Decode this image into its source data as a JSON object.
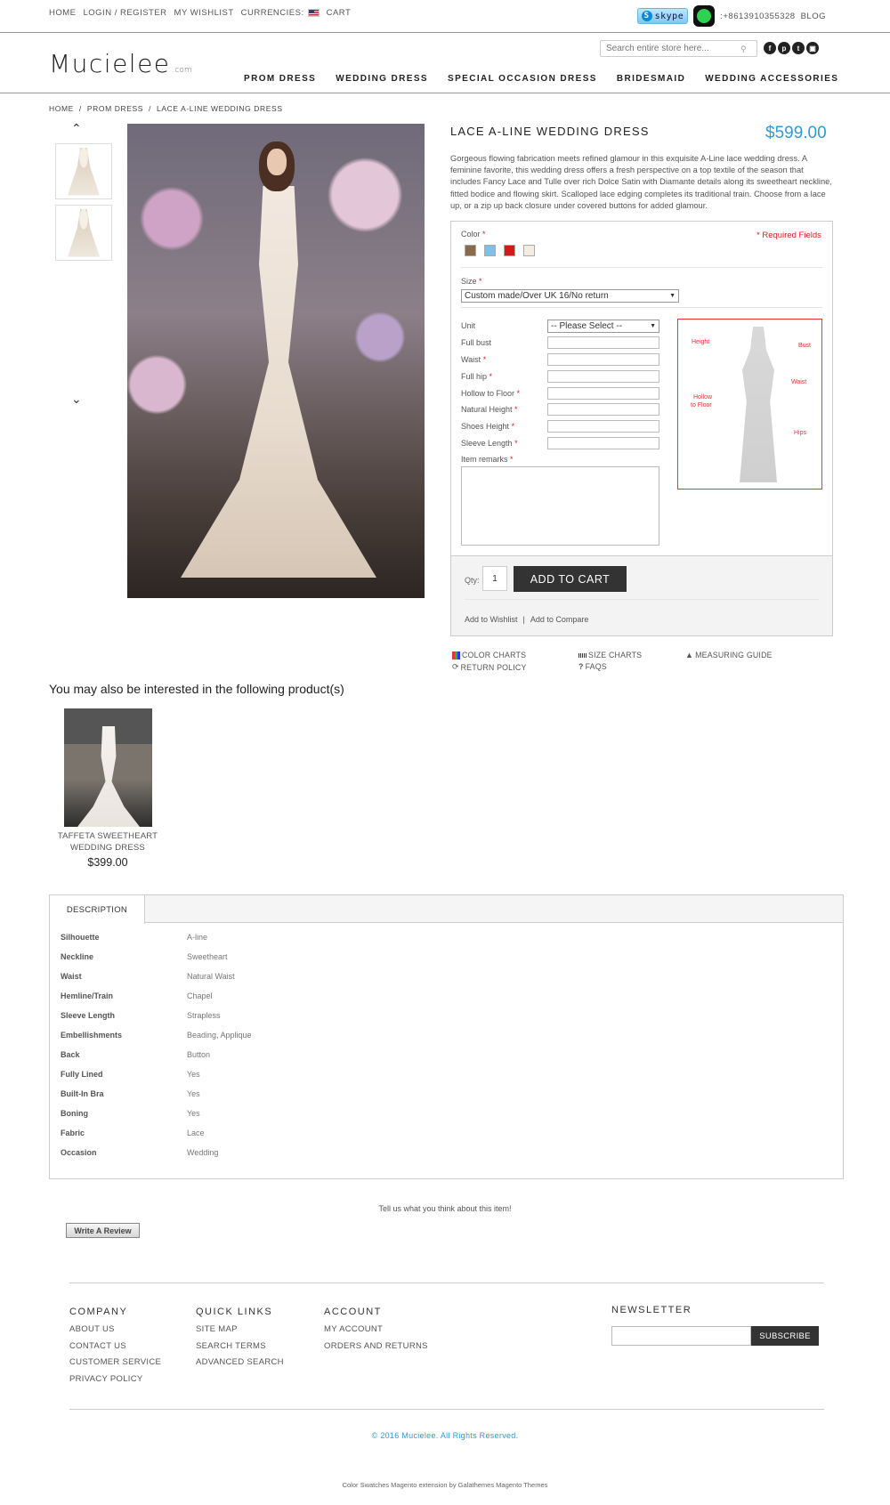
{
  "toplinks": {
    "home": "HOME",
    "login": "LOGIN / REGISTER",
    "wishlist": "MY WISHLIST",
    "currencies": "CURRENCIES:",
    "cart": "CART",
    "skype": "skype",
    "phone": ":+8613910355328",
    "blog": "BLOG"
  },
  "header": {
    "logo": "Mucielee",
    "logo_suffix": ".com",
    "search_placeholder": "Search entire store here...",
    "social_icons": [
      "facebook-icon",
      "pinterest-icon",
      "twitter-icon",
      "instagram-icon"
    ]
  },
  "nav": [
    "PROM DRESS",
    "WEDDING DRESS",
    "SPECIAL OCCASION DRESS",
    "BRIDESMAID",
    "WEDDING ACCESSORIES"
  ],
  "breadcrumb": [
    "HOME",
    "/",
    "PROM DRESS",
    "/",
    "LACE A-LINE WEDDING DRESS"
  ],
  "product": {
    "title": "LACE A-LINE WEDDING DRESS",
    "price": "$599.00",
    "description": "Gorgeous flowing fabrication meets refined glamour in this exquisite A-Line lace wedding dress. A feminine favorite, this wedding dress offers a fresh perspective on a top textile of the season that includes Fancy Lace and Tulle over rich Dolce Satin with Diamante details along its sweetheart neckline, fitted bodice and flowing skirt. Scalloped lace edging completes its traditional train. Choose from a lace up, or a zip up back closure under covered buttons for added glamour."
  },
  "options": {
    "color_label": "Color",
    "required_note": "* Required Fields",
    "swatch_colors": [
      "#8a6a4a",
      "#7fc0e8",
      "#d11a1a",
      "#f3ece0"
    ],
    "size_label": "Size",
    "size_value": "Custom made/Over UK 16/No return",
    "unit_label": "Unit",
    "unit_value": "-- Please Select --",
    "fields": [
      "Full bust",
      "Waist",
      "Full hip",
      "Hollow to Floor",
      "Natural Height",
      "Shoes Height",
      "Sleeve Length",
      "Item remarks"
    ],
    "chart_labels": [
      "Height",
      "Bust",
      "Waist",
      "Hollow",
      "to Floor",
      "Hips"
    ]
  },
  "cart": {
    "qty_label": "Qty:",
    "qty": "1",
    "add_to_cart": "ADD TO CART",
    "add_to_wishlist": "Add to Wishlist",
    "separator": "|",
    "add_to_compare": "Add to Compare"
  },
  "guides": {
    "color_charts": "COLOR CHARTS",
    "size_charts": "SIZE CHARTS",
    "measuring_guide": "MEASURING GUIDE",
    "return_policy": "RETURN POLICY",
    "faqs": "FAQS"
  },
  "related": {
    "heading": "You may also be interested in the following product(s)",
    "name": "TAFFETA SWEETHEART WEDDING DRESS",
    "price": "$399.00"
  },
  "description_tab": {
    "tab": "DESCRIPTION",
    "attributes": [
      {
        "k": "Silhouette",
        "v": "A-line"
      },
      {
        "k": "Neckline",
        "v": "Sweetheart"
      },
      {
        "k": "Waist",
        "v": "Natural Waist"
      },
      {
        "k": "Hemline/Train",
        "v": "Chapel"
      },
      {
        "k": "Sleeve Length",
        "v": "Strapless"
      },
      {
        "k": "Embellishments",
        "v": "Beading, Applique"
      },
      {
        "k": "Back",
        "v": "Button"
      },
      {
        "k": "Fully Lined",
        "v": "Yes"
      },
      {
        "k": "Built-In Bra",
        "v": "Yes"
      },
      {
        "k": "Boning",
        "v": "Yes"
      },
      {
        "k": "Fabric",
        "v": "Lace"
      },
      {
        "k": "Occasion",
        "v": "Wedding"
      }
    ]
  },
  "review": {
    "prompt": "Tell us what you think about this item!",
    "button": "Write A Review"
  },
  "footer": {
    "company_h": "COMPANY",
    "company": [
      "ABOUT US",
      "CONTACT US",
      "CUSTOMER SERVICE",
      "PRIVACY POLICY"
    ],
    "quick_h": "QUICK LINKS",
    "quick": [
      "SITE MAP",
      "SEARCH TERMS",
      "ADVANCED SEARCH"
    ],
    "account_h": "ACCOUNT",
    "account": [
      "MY ACCOUNT",
      "ORDERS AND RETURNS"
    ],
    "newsletter_h": "NEWSLETTER",
    "subscribe": "SUBSCRIBE",
    "copyright": "© 2016 Mucielee. All Rights Reserved.",
    "credit": "Color Swatches Magento extension by Galathemes Magento Themes"
  },
  "colors": {
    "accent": "#2e9bd6",
    "required": "#dd2222",
    "button_dark": "#333333"
  }
}
